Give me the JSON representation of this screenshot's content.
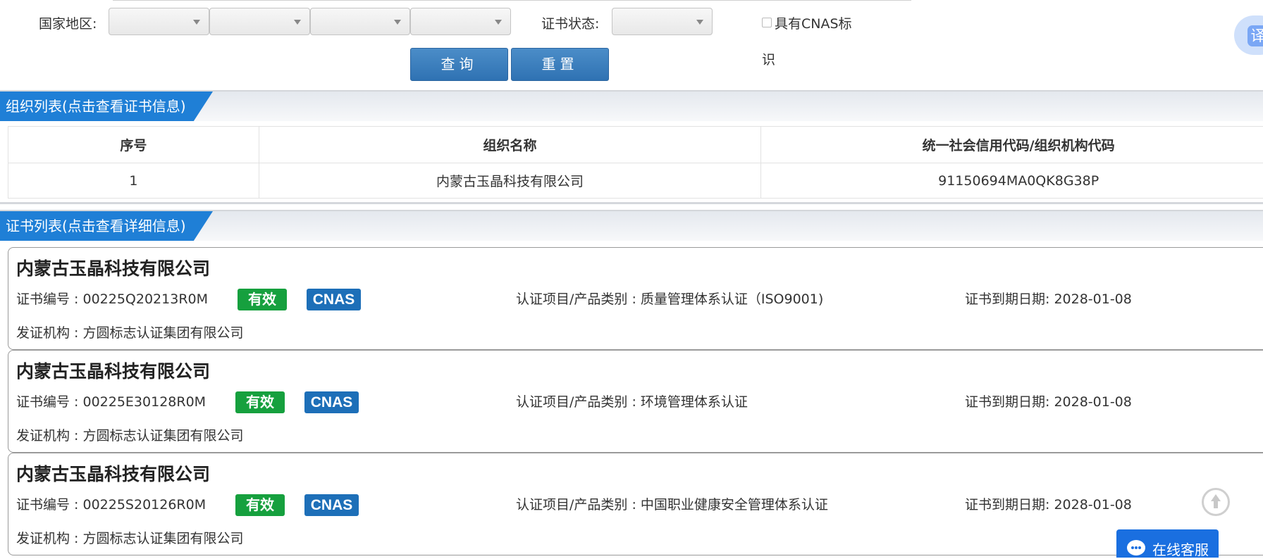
{
  "search": {
    "region_label": "国家地区:",
    "status_label": "证书状态:",
    "cnas_label_line1": "具有CNAS标",
    "cnas_label_line2": "识",
    "query_button": "查询",
    "reset_button": "重置",
    "translate_icon_text": "译"
  },
  "org_section": {
    "title": "组织列表(点击查看证书信息)",
    "columns": [
      "序号",
      "组织名称",
      "统一社会信用代码/组织机构代码"
    ],
    "rows": [
      [
        "1",
        "内蒙古玉晶科技有限公司",
        "91150694MA0QK8G38P"
      ]
    ]
  },
  "cert_section": {
    "title": "证书列表(点击查看详细信息)",
    "cards": [
      {
        "company": "内蒙古玉晶科技有限公司",
        "cert_no": "证书编号 : 00225Q20213R0M",
        "status": "有效",
        "cnas": "CNAS",
        "category": "认证项目/产品类别 : 质量管理体系认证（ISO9001)",
        "expiry": "证书到期日期: 2028-01-08",
        "issuer": "发证机构 : 方圆标志认证集团有限公司"
      },
      {
        "company": "内蒙古玉晶科技有限公司",
        "cert_no": "证书编号 : 00225E30128R0M",
        "status": "有效",
        "cnas": "CNAS",
        "category": "认证项目/产品类别 : 环境管理体系认证",
        "expiry": "证书到期日期: 2028-01-08",
        "issuer": "发证机构 : 方圆标志认证集团有限公司"
      },
      {
        "company": "内蒙古玉晶科技有限公司",
        "cert_no": "证书编号 : 00225S20126R0M",
        "status": "有效",
        "cnas": "CNAS",
        "category": "认证项目/产品类别 : 中国职业健康安全管理体系认证",
        "expiry": "证书到期日期: 2028-01-08",
        "issuer": "发证机构 : 方圆标志认证集团有限公司"
      }
    ]
  },
  "widgets": {
    "service_label": "在线客服",
    "back_to_top_icon": "arrow-up-circle-icon",
    "chat_icon": "chat-bubble-icon"
  },
  "colors": {
    "section_blue": "#1f7fd6",
    "button_blue": "#2f72b3",
    "valid_green": "#16a03e",
    "cnas_blue": "#1d6fb8"
  }
}
